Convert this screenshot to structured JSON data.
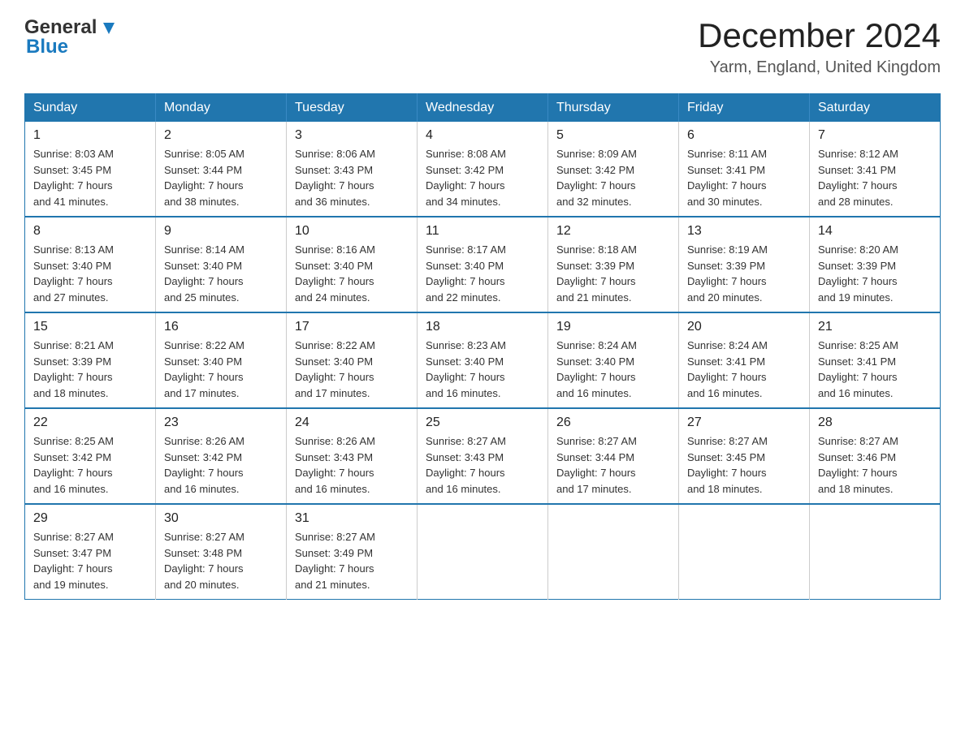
{
  "header": {
    "logo_general": "General",
    "logo_blue": "Blue",
    "title": "December 2024",
    "subtitle": "Yarm, England, United Kingdom"
  },
  "columns": [
    "Sunday",
    "Monday",
    "Tuesday",
    "Wednesday",
    "Thursday",
    "Friday",
    "Saturday"
  ],
  "weeks": [
    [
      {
        "day": "1",
        "sunrise": "Sunrise: 8:03 AM",
        "sunset": "Sunset: 3:45 PM",
        "daylight": "Daylight: 7 hours",
        "daylight2": "and 41 minutes."
      },
      {
        "day": "2",
        "sunrise": "Sunrise: 8:05 AM",
        "sunset": "Sunset: 3:44 PM",
        "daylight": "Daylight: 7 hours",
        "daylight2": "and 38 minutes."
      },
      {
        "day": "3",
        "sunrise": "Sunrise: 8:06 AM",
        "sunset": "Sunset: 3:43 PM",
        "daylight": "Daylight: 7 hours",
        "daylight2": "and 36 minutes."
      },
      {
        "day": "4",
        "sunrise": "Sunrise: 8:08 AM",
        "sunset": "Sunset: 3:42 PM",
        "daylight": "Daylight: 7 hours",
        "daylight2": "and 34 minutes."
      },
      {
        "day": "5",
        "sunrise": "Sunrise: 8:09 AM",
        "sunset": "Sunset: 3:42 PM",
        "daylight": "Daylight: 7 hours",
        "daylight2": "and 32 minutes."
      },
      {
        "day": "6",
        "sunrise": "Sunrise: 8:11 AM",
        "sunset": "Sunset: 3:41 PM",
        "daylight": "Daylight: 7 hours",
        "daylight2": "and 30 minutes."
      },
      {
        "day": "7",
        "sunrise": "Sunrise: 8:12 AM",
        "sunset": "Sunset: 3:41 PM",
        "daylight": "Daylight: 7 hours",
        "daylight2": "and 28 minutes."
      }
    ],
    [
      {
        "day": "8",
        "sunrise": "Sunrise: 8:13 AM",
        "sunset": "Sunset: 3:40 PM",
        "daylight": "Daylight: 7 hours",
        "daylight2": "and 27 minutes."
      },
      {
        "day": "9",
        "sunrise": "Sunrise: 8:14 AM",
        "sunset": "Sunset: 3:40 PM",
        "daylight": "Daylight: 7 hours",
        "daylight2": "and 25 minutes."
      },
      {
        "day": "10",
        "sunrise": "Sunrise: 8:16 AM",
        "sunset": "Sunset: 3:40 PM",
        "daylight": "Daylight: 7 hours",
        "daylight2": "and 24 minutes."
      },
      {
        "day": "11",
        "sunrise": "Sunrise: 8:17 AM",
        "sunset": "Sunset: 3:40 PM",
        "daylight": "Daylight: 7 hours",
        "daylight2": "and 22 minutes."
      },
      {
        "day": "12",
        "sunrise": "Sunrise: 8:18 AM",
        "sunset": "Sunset: 3:39 PM",
        "daylight": "Daylight: 7 hours",
        "daylight2": "and 21 minutes."
      },
      {
        "day": "13",
        "sunrise": "Sunrise: 8:19 AM",
        "sunset": "Sunset: 3:39 PM",
        "daylight": "Daylight: 7 hours",
        "daylight2": "and 20 minutes."
      },
      {
        "day": "14",
        "sunrise": "Sunrise: 8:20 AM",
        "sunset": "Sunset: 3:39 PM",
        "daylight": "Daylight: 7 hours",
        "daylight2": "and 19 minutes."
      }
    ],
    [
      {
        "day": "15",
        "sunrise": "Sunrise: 8:21 AM",
        "sunset": "Sunset: 3:39 PM",
        "daylight": "Daylight: 7 hours",
        "daylight2": "and 18 minutes."
      },
      {
        "day": "16",
        "sunrise": "Sunrise: 8:22 AM",
        "sunset": "Sunset: 3:40 PM",
        "daylight": "Daylight: 7 hours",
        "daylight2": "and 17 minutes."
      },
      {
        "day": "17",
        "sunrise": "Sunrise: 8:22 AM",
        "sunset": "Sunset: 3:40 PM",
        "daylight": "Daylight: 7 hours",
        "daylight2": "and 17 minutes."
      },
      {
        "day": "18",
        "sunrise": "Sunrise: 8:23 AM",
        "sunset": "Sunset: 3:40 PM",
        "daylight": "Daylight: 7 hours",
        "daylight2": "and 16 minutes."
      },
      {
        "day": "19",
        "sunrise": "Sunrise: 8:24 AM",
        "sunset": "Sunset: 3:40 PM",
        "daylight": "Daylight: 7 hours",
        "daylight2": "and 16 minutes."
      },
      {
        "day": "20",
        "sunrise": "Sunrise: 8:24 AM",
        "sunset": "Sunset: 3:41 PM",
        "daylight": "Daylight: 7 hours",
        "daylight2": "and 16 minutes."
      },
      {
        "day": "21",
        "sunrise": "Sunrise: 8:25 AM",
        "sunset": "Sunset: 3:41 PM",
        "daylight": "Daylight: 7 hours",
        "daylight2": "and 16 minutes."
      }
    ],
    [
      {
        "day": "22",
        "sunrise": "Sunrise: 8:25 AM",
        "sunset": "Sunset: 3:42 PM",
        "daylight": "Daylight: 7 hours",
        "daylight2": "and 16 minutes."
      },
      {
        "day": "23",
        "sunrise": "Sunrise: 8:26 AM",
        "sunset": "Sunset: 3:42 PM",
        "daylight": "Daylight: 7 hours",
        "daylight2": "and 16 minutes."
      },
      {
        "day": "24",
        "sunrise": "Sunrise: 8:26 AM",
        "sunset": "Sunset: 3:43 PM",
        "daylight": "Daylight: 7 hours",
        "daylight2": "and 16 minutes."
      },
      {
        "day": "25",
        "sunrise": "Sunrise: 8:27 AM",
        "sunset": "Sunset: 3:43 PM",
        "daylight": "Daylight: 7 hours",
        "daylight2": "and 16 minutes."
      },
      {
        "day": "26",
        "sunrise": "Sunrise: 8:27 AM",
        "sunset": "Sunset: 3:44 PM",
        "daylight": "Daylight: 7 hours",
        "daylight2": "and 17 minutes."
      },
      {
        "day": "27",
        "sunrise": "Sunrise: 8:27 AM",
        "sunset": "Sunset: 3:45 PM",
        "daylight": "Daylight: 7 hours",
        "daylight2": "and 18 minutes."
      },
      {
        "day": "28",
        "sunrise": "Sunrise: 8:27 AM",
        "sunset": "Sunset: 3:46 PM",
        "daylight": "Daylight: 7 hours",
        "daylight2": "and 18 minutes."
      }
    ],
    [
      {
        "day": "29",
        "sunrise": "Sunrise: 8:27 AM",
        "sunset": "Sunset: 3:47 PM",
        "daylight": "Daylight: 7 hours",
        "daylight2": "and 19 minutes."
      },
      {
        "day": "30",
        "sunrise": "Sunrise: 8:27 AM",
        "sunset": "Sunset: 3:48 PM",
        "daylight": "Daylight: 7 hours",
        "daylight2": "and 20 minutes."
      },
      {
        "day": "31",
        "sunrise": "Sunrise: 8:27 AM",
        "sunset": "Sunset: 3:49 PM",
        "daylight": "Daylight: 7 hours",
        "daylight2": "and 21 minutes."
      },
      null,
      null,
      null,
      null
    ]
  ]
}
